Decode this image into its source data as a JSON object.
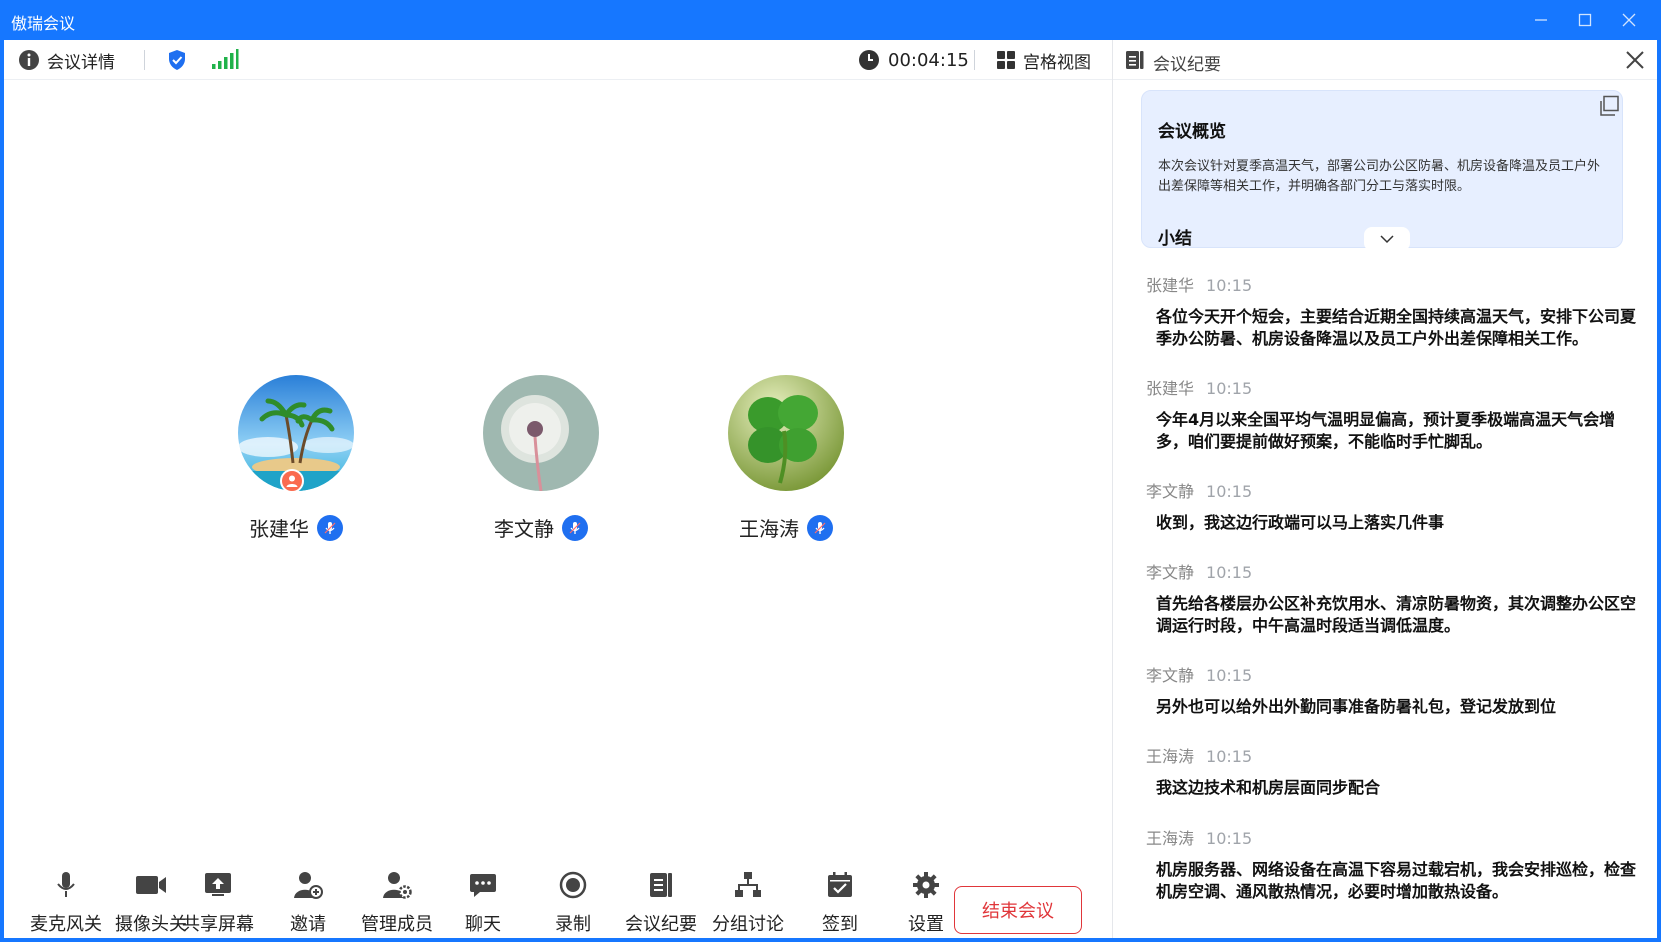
{
  "window": {
    "title": "傲瑞会议"
  },
  "topbar": {
    "meeting_info_label": "会议详情",
    "timer": "00:04:15",
    "view_label": "宫格视图"
  },
  "participants": [
    {
      "name": "张建华",
      "avatar": "palm-island",
      "is_host": true,
      "mic": "on"
    },
    {
      "name": "李文静",
      "avatar": "dandelion",
      "is_host": false,
      "mic": "on"
    },
    {
      "name": "王海涛",
      "avatar": "clover",
      "is_host": false,
      "mic": "on"
    }
  ],
  "toolbar": {
    "items": [
      {
        "label": "麦克风关",
        "icon": "microphone-icon"
      },
      {
        "label": "摄像头关",
        "icon": "camera-icon"
      },
      {
        "label": "共享屏幕",
        "icon": "share-screen-icon"
      },
      {
        "label": "邀请",
        "icon": "invite-icon"
      },
      {
        "label": "管理成员",
        "icon": "manage-members-icon"
      },
      {
        "label": "聊天",
        "icon": "chat-icon"
      },
      {
        "label": "录制",
        "icon": "record-icon"
      },
      {
        "label": "会议纪要",
        "icon": "minutes-icon"
      },
      {
        "label": "分组讨论",
        "icon": "breakout-icon"
      },
      {
        "label": "签到",
        "icon": "checkin-icon"
      },
      {
        "label": "设置",
        "icon": "settings-icon"
      }
    ],
    "end_label": "结束会议"
  },
  "side": {
    "title": "会议纪要",
    "summary": {
      "heading": "会议概览",
      "text": "本次会议针对夏季高温天气，部署公司办公区防暑、机房设备降温及员工户外出差保障等相关工作，并明确各部门分工与落实时限。",
      "sub_heading": "小结"
    },
    "messages": [
      {
        "speaker": "张建华",
        "time": "10:15",
        "text": "各位今天开个短会，主要结合近期全国持续高温天气，安排下公司夏季办公防暑、机房设备降温以及员工户外出差保障相关工作。"
      },
      {
        "speaker": "张建华",
        "time": "10:15",
        "text": "今年4月以来全国平均气温明显偏高，预计夏季极端高温天气会增多，咱们要提前做好预案，不能临时手忙脚乱。"
      },
      {
        "speaker": "李文静",
        "time": "10:15",
        "text": "收到，我这边行政端可以马上落实几件事"
      },
      {
        "speaker": "李文静",
        "time": "10:15",
        "text": "首先给各楼层办公区补充饮用水、清凉防暑物资，其次调整办公区空调运行时段，中午高温时段适当调低温度。"
      },
      {
        "speaker": "李文静",
        "time": "10:15",
        "text": "另外也可以给外出外勤同事准备防暑礼包，登记发放到位"
      },
      {
        "speaker": "王海涛",
        "time": "10:15",
        "text": "我这边技术和机房层面同步配合"
      },
      {
        "speaker": "王海涛",
        "time": "10:15",
        "text": "机房服务器、网络设备在高温下容易过载宕机，我会安排巡检，检查机房空调、通风散热情况，必要时增加散热设备。"
      }
    ]
  },
  "colors": {
    "brand": "#1677ff",
    "end": "#e0363a",
    "mic_badge": "#1f6ff0",
    "host_badge": "#fa6b4f",
    "signal": "#20b24a"
  }
}
